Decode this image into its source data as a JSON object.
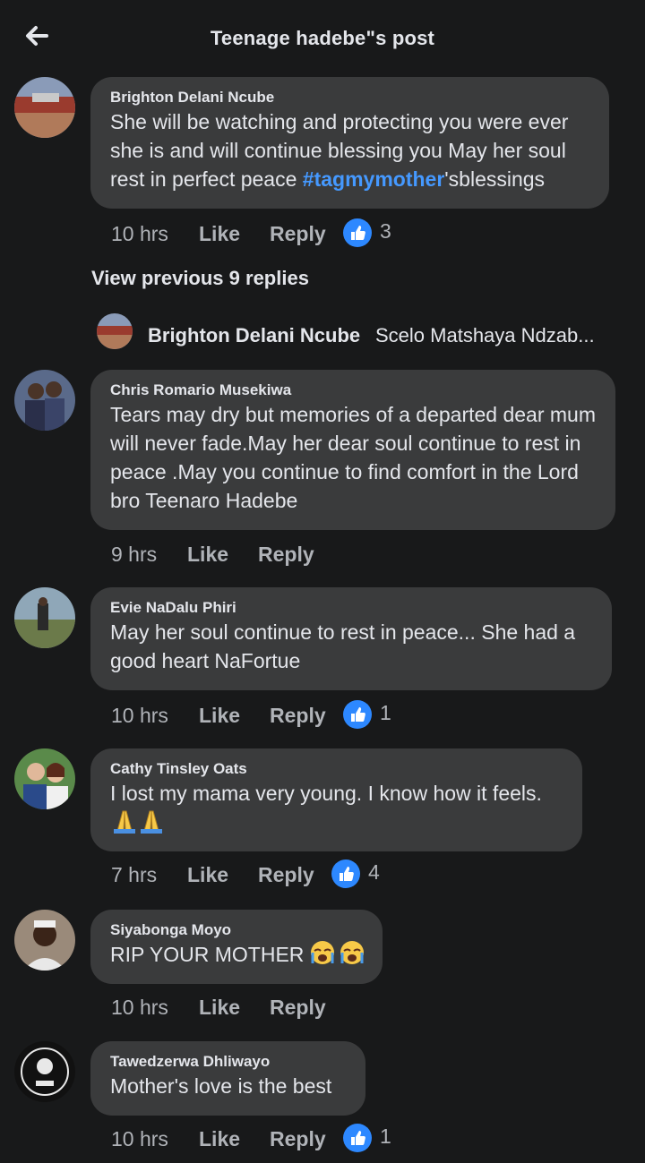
{
  "header": {
    "title": "Teenage hadebe\"s post"
  },
  "comments": [
    {
      "author": "Brighton Delani Ncube",
      "text_before": "She will be watching and protecting you were ever she is and will continue blessing you May her soul rest in perfect peace ",
      "hashtag": "#tagmymother",
      "text_after": "'sblessings",
      "time": "10 hrs",
      "like": "Like",
      "reply": "Reply",
      "reactions": "3"
    },
    {
      "author": "Chris Romario Musekiwa",
      "text": "Tears may dry but memories of a departed dear mum will never fade.May her dear soul continue to rest in peace .May you continue to find comfort in the Lord bro Teenaro Hadebe",
      "time": "9 hrs",
      "like": "Like",
      "reply": "Reply"
    },
    {
      "author": "Evie NaDalu Phiri",
      "text": "May her soul continue to rest in peace... She had a good heart NaFortue",
      "time": "10 hrs",
      "like": "Like",
      "reply": "Reply",
      "reactions": "1"
    },
    {
      "author": "Cathy Tinsley Oats",
      "text": "I lost my mama very young. I know how it feels.",
      "emoji": "folded-hands-emoji x2",
      "time": "7 hrs",
      "like": "Like",
      "reply": "Reply",
      "reactions": "4"
    },
    {
      "author": "Siyabonga Moyo",
      "text": "RIP YOUR MOTHER",
      "emoji": "loudly-crying-face-emoji x2",
      "time": "10 hrs",
      "like": "Like",
      "reply": "Reply"
    },
    {
      "author": "Tawedzerwa Dhliwayo",
      "text": "Mother's love is the best",
      "time": "10 hrs",
      "like": "Like",
      "reply": "Reply",
      "reactions": "1"
    }
  ],
  "view_previous": "View previous 9 replies",
  "reply_preview": {
    "author": "Brighton Delani Ncube",
    "text": "Scelo Matshaya Ndzab..."
  },
  "colors": {
    "background": "#18191a",
    "bubble": "#3a3b3c",
    "accent": "#2d88ff",
    "hashtag": "#4599ff",
    "meta": "#b0b3b8"
  }
}
